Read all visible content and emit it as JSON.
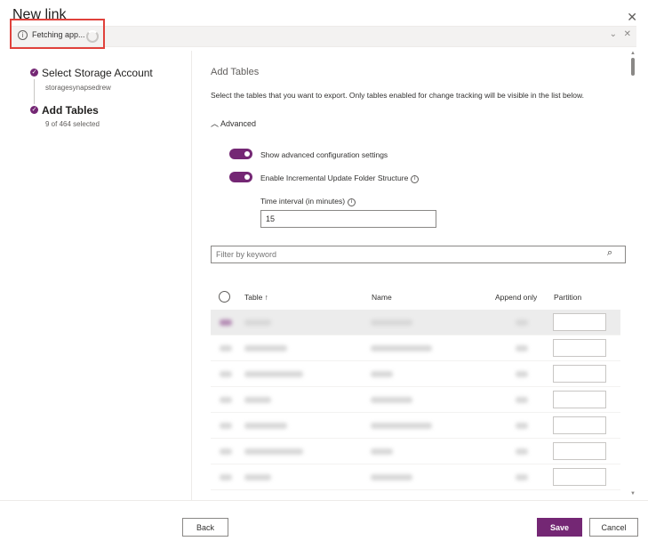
{
  "dialog": {
    "title": "New link",
    "close_icon": "close-icon"
  },
  "infobar": {
    "text": "Fetching app...",
    "info_icon": "info-icon",
    "expand_icon": "chevron-double-down-icon",
    "dismiss_icon": "close-icon"
  },
  "steps": [
    {
      "title": "Select Storage Account",
      "subtitle": "storagesynapsedrew",
      "bold": false
    },
    {
      "title": "Add Tables",
      "subtitle": "9 of 464 selected",
      "bold": true
    }
  ],
  "main": {
    "heading": "Add Tables",
    "description": "Select the tables that you want to export. Only tables enabled for change tracking will be visible in the list below.",
    "advanced_label": "Advanced",
    "toggles": [
      {
        "label": "Show advanced configuration settings",
        "on": true,
        "info": false
      },
      {
        "label": "Enable Incremental Update Folder Structure",
        "on": true,
        "info": true
      }
    ],
    "interval": {
      "label": "Time interval (in minutes)",
      "value": "15"
    },
    "filter": {
      "placeholder": "Filter by keyword"
    },
    "table": {
      "headers": {
        "table": "Table ↑",
        "name": "Name",
        "append_only": "Append only",
        "partition": "Partition"
      },
      "row_count": 7
    }
  },
  "footer": {
    "back": "Back",
    "save": "Save",
    "cancel": "Cancel"
  },
  "colors": {
    "accent": "#742774",
    "highlight": "#e0413b"
  }
}
